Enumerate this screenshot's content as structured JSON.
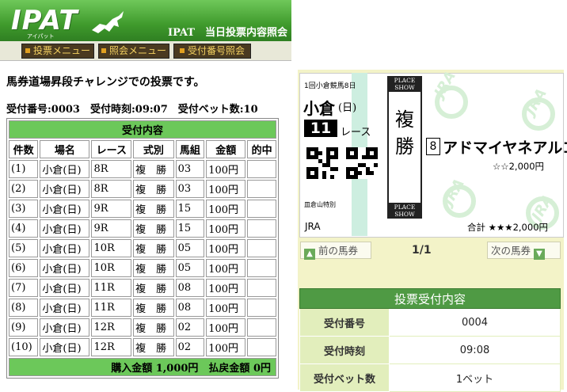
{
  "header": {
    "logo": "IPAT",
    "logo_sub": "アイパット",
    "title": "IPAT　当日投票内容照会"
  },
  "menu": [
    "投票メニュー",
    "照会メニュー",
    "受付番号照会"
  ],
  "notice": "馬券道場昇段チャレンジでの投票です。",
  "receipt_line": "受付番号:0003　受付時刻:09:07　受付ベット数:10",
  "table": {
    "caption": "受付内容",
    "headers": [
      "件数",
      "場名",
      "レース",
      "式別",
      "馬組",
      "金額",
      "的中"
    ],
    "rows": [
      [
        "(1)",
        "小倉(日)",
        "8R",
        "複　勝",
        "03",
        "100円",
        ""
      ],
      [
        "(2)",
        "小倉(日)",
        "8R",
        "複　勝",
        "03",
        "100円",
        ""
      ],
      [
        "(3)",
        "小倉(日)",
        "9R",
        "複　勝",
        "15",
        "100円",
        ""
      ],
      [
        "(4)",
        "小倉(日)",
        "9R",
        "複　勝",
        "15",
        "100円",
        ""
      ],
      [
        "(5)",
        "小倉(日)",
        "10R",
        "複　勝",
        "05",
        "100円",
        ""
      ],
      [
        "(6)",
        "小倉(日)",
        "10R",
        "複　勝",
        "05",
        "100円",
        ""
      ],
      [
        "(7)",
        "小倉(日)",
        "11R",
        "複　勝",
        "08",
        "100円",
        ""
      ],
      [
        "(8)",
        "小倉(日)",
        "11R",
        "複　勝",
        "08",
        "100円",
        ""
      ],
      [
        "(9)",
        "小倉(日)",
        "12R",
        "複　勝",
        "02",
        "100円",
        ""
      ],
      [
        "(10)",
        "小倉(日)",
        "12R",
        "複　勝",
        "02",
        "100円",
        ""
      ]
    ],
    "footer": "購入金額 1,000円　払戻金額 0円"
  },
  "ticket": {
    "meeting": "1回小倉競馬8日",
    "venue": "小倉",
    "day": "(日)",
    "race_no": "11",
    "race_label": "レース",
    "race_name": "皿倉山特別",
    "place_show_top": "PLACE\nSHOW",
    "bet_type": "複\n勝",
    "place_show_bottom": "PLACE\nSHOW",
    "horse_no": "8",
    "horse_name": "アドマイヤネアルコ",
    "horse_amount": "☆☆2,000円",
    "jra": "JRA",
    "total": "合計 ★★★2,000円",
    "watermark": "JRA"
  },
  "nav": {
    "prev": "前の馬券",
    "page": "1/1",
    "next": "次の馬券"
  },
  "receipt": {
    "caption": "投票受付内容",
    "rows": [
      {
        "label": "受付番号",
        "value": "0004"
      },
      {
        "label": "受付時刻",
        "value": "09:08"
      },
      {
        "label": "受付ベット数",
        "value": "1ベット"
      }
    ]
  }
}
